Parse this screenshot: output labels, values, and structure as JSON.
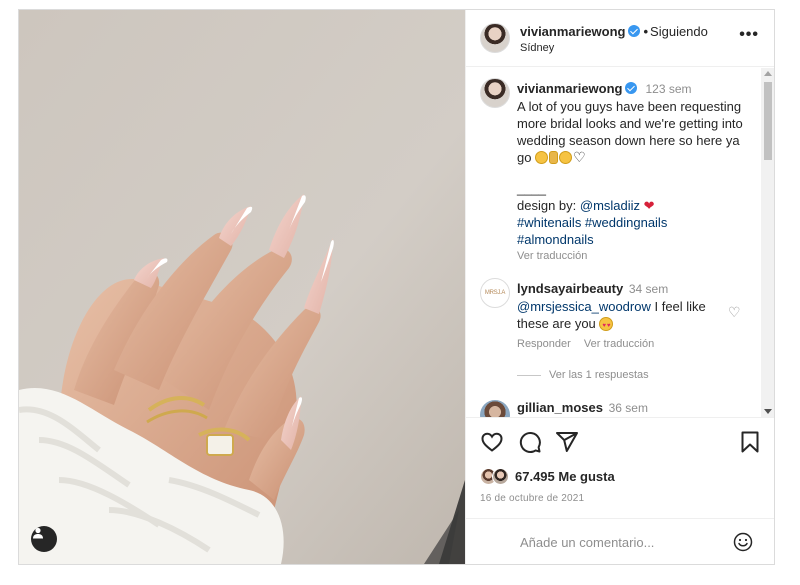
{
  "header": {
    "username": "vivianmariewong",
    "separator": "•",
    "follow_status": "Siguiendo",
    "location": "Sídney",
    "more_label": "•••"
  },
  "caption": {
    "username": "vivianmariewong",
    "time": "123 sem",
    "text": "A lot of you guys have been requesting more bridal looks and we're getting into wedding season down here so here ya go",
    "divider": "____",
    "design_by_prefix": "design by:",
    "design_by_handle": "@msladiiz",
    "hashtags_line1": "#whitenails #weddingnails",
    "hashtags_line2": "#almondnails",
    "translate": "Ver traducción"
  },
  "comments": [
    {
      "avatar_text": "MRSJ.A",
      "username": "lyndsayairbeauty",
      "time": "34 sem",
      "mention": "@mrsjessica_woodrow",
      "text": "I feel like these are you",
      "reply": "Responder",
      "translate": "Ver traducción",
      "replies": "Ver las 1 respuestas"
    },
    {
      "username": "gillian_moses",
      "time": "36 sem"
    }
  ],
  "actions": {
    "likes": "67.495 Me gusta",
    "date": "16 de octubre de 2021"
  },
  "composer": {
    "placeholder": "Añade un comentario..."
  },
  "colors": {
    "text": "#262626",
    "muted": "#8e8e8e",
    "link": "#00376b",
    "verified": "#3897f0",
    "border": "#dbdbdb"
  }
}
